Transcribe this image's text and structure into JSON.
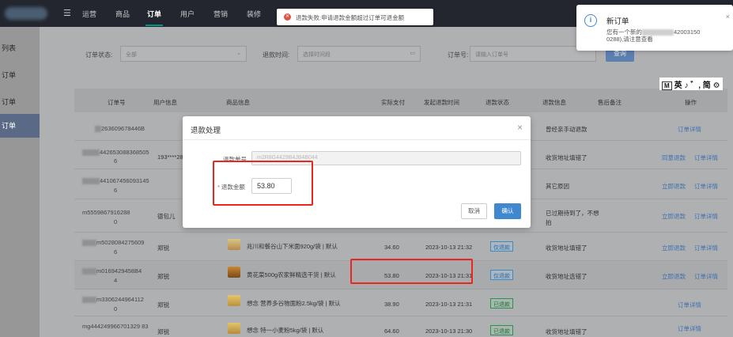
{
  "nav": {
    "menu_icon": "menu-icon",
    "tabs": [
      "运营",
      "商品",
      "订单",
      "用户",
      "营销",
      "装修"
    ]
  },
  "sidebar": {
    "items": [
      "列表",
      "订单",
      "订单",
      "订单"
    ]
  },
  "filters": {
    "status_label": "订单状态:",
    "status_value": "全部",
    "refund_time_label": "退款时间:",
    "refund_time_placeholder": "选择时间段",
    "order_no_label": "订单号:",
    "order_no_placeholder": "请输入订单号",
    "search_button": "查询"
  },
  "table": {
    "headers": [
      "订单号",
      "用户信息",
      "商品信息",
      "实际支付",
      "发起退款时间",
      "退款状态",
      "退款信息",
      "售后备注",
      "操作"
    ],
    "rows": [
      {
        "order": "263609678446B",
        "user": "",
        "product": "",
        "amount": "",
        "time": "",
        "status": "",
        "info": "曾经亲手动退款",
        "actions": [
          "订单详情"
        ]
      },
      {
        "order_a": "442653088368505",
        "order_b": "6",
        "user": "193****28",
        "product": "",
        "amount": "",
        "time": "",
        "status": "",
        "info": "收货地址填错了",
        "actions": [
          "同意退款",
          "订单详情"
        ]
      },
      {
        "order_a": "441067456093145",
        "order_b": "6",
        "user": "",
        "product": "",
        "amount": "",
        "time": "",
        "status": "",
        "info": "其它原因",
        "actions": [
          "立即退款",
          "订单详情"
        ]
      },
      {
        "order_a": "m5559867916288",
        "order_b": "0",
        "user": "德包儿",
        "product": "",
        "amount": "",
        "time": "",
        "status": "",
        "info_a": "已过期待到了，不想",
        "info_b": "拍",
        "actions": [
          "立即退款",
          "订单详情"
        ]
      },
      {
        "order_a": "m5028084275609",
        "order_b": "6",
        "user": "郑锐",
        "product": "兆川和餐谷山下米面920g/袋 | 默认",
        "amount": "34.60",
        "time": "2023-10-13 21:32",
        "status": "仅退款",
        "info": "收货地址填错了",
        "actions": [
          "立即退款",
          "订单详情"
        ]
      },
      {
        "order_a": "m0169429458B4",
        "order_b": "4",
        "user": "郑锐",
        "product": "黄花菜500g农家鲜精选干货 | 默认",
        "amount": "53.80",
        "time": "2023-10-13 21:31",
        "status": "仅退款",
        "info": "收货地址选错了",
        "actions": [
          "立即退款",
          "订单详情"
        ]
      },
      {
        "order_a": "m3306244964112",
        "order_b": "0",
        "user": "郑锐",
        "product": "想念 营养多谷物面粉2.5kg/袋 | 默认",
        "amount": "38.90",
        "time": "2023-10-13 21:31",
        "status": "已退款",
        "info": "",
        "actions": [
          "订单详情"
        ]
      },
      {
        "order_a": "mg444249966701329 83",
        "order_b": "",
        "user": "郑锐",
        "product": "想念 特一小麦粉5kg/袋 | 默认",
        "amount": "64.60",
        "time": "2023-10-13 21:30",
        "status": "已退款",
        "info": "收货地址填错了",
        "actions": [
          "订单详情"
        ]
      }
    ]
  },
  "dialog": {
    "title": "退款处理",
    "refund_no_label": "退款单号",
    "refund_no_value": "m2R8G4429B4JB4B044",
    "amount_label": "退款金额",
    "amount_value": "53.80",
    "cancel": "取消",
    "confirm": "确认"
  },
  "toast": {
    "message": "退款失败:申请退款金额超过订单可退金额"
  },
  "notification": {
    "title": "新订单",
    "line1_a": "您有一个新的",
    "line1_b": "42003150",
    "line2": "0288),请注意查看",
    "close": "×"
  },
  "ime": {
    "label": "M",
    "text": "英 ♪ ゛, 简 ⚙"
  },
  "colors": {
    "accent": "#3f88d0",
    "nav": "#23262e",
    "annotation": "#e8281e",
    "error": "#e25248"
  }
}
